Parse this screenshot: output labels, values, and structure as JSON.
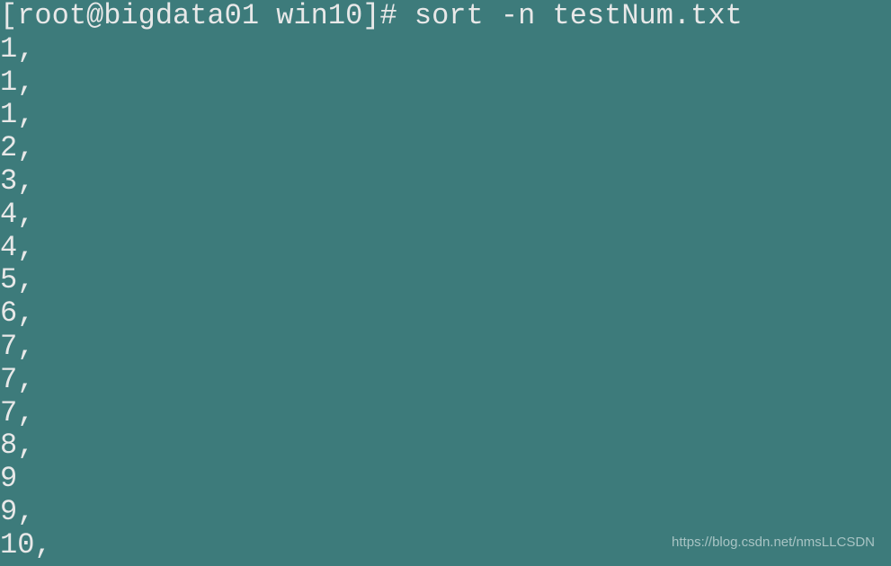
{
  "terminal": {
    "prompt": "[root@bigdata01 win10]# ",
    "command": "sort -n testNum.txt",
    "output": [
      "1,",
      "1,",
      "1,",
      "2,",
      "3,",
      "4,",
      "4,",
      "5,",
      "6,",
      "7,",
      "7,",
      "7,",
      "8,",
      "9",
      "9,",
      "10,"
    ]
  },
  "watermark": "https://blog.csdn.net/nmsLLCSDN"
}
